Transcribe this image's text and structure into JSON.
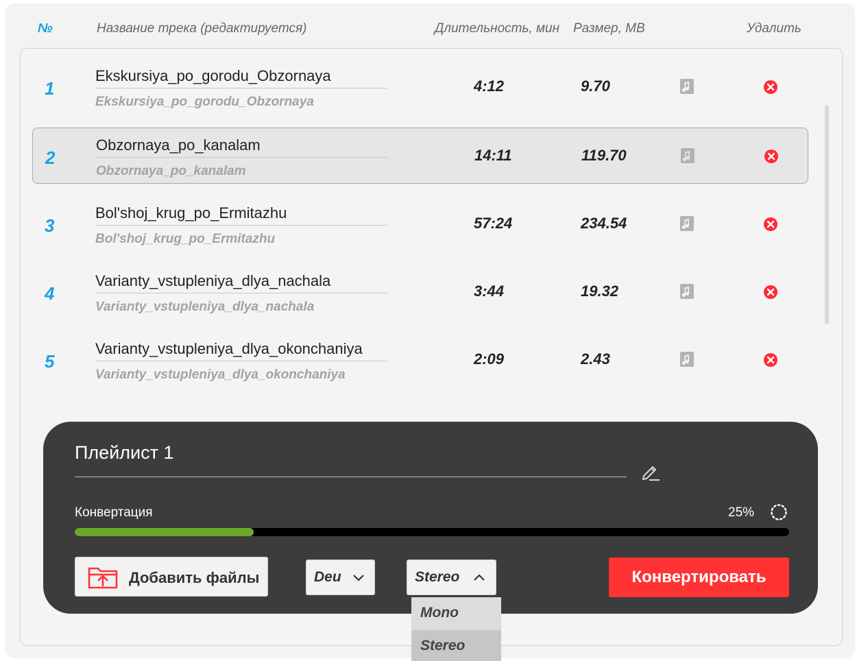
{
  "headers": {
    "num": "№",
    "title": "Название трека (редактируется)",
    "duration": "Длительность, мин",
    "size": "Размер, MB",
    "delete": "Удалить"
  },
  "tracks": [
    {
      "num": "1",
      "name": "Ekskursiya_po_gorodu_Obzornaya",
      "original": "Ekskursiya_po_gorodu_Obzornaya",
      "duration": "4:12",
      "size": "9.70"
    },
    {
      "num": "2",
      "name": "Obzornaya_po_kanalam",
      "original": "Obzornaya_po_kanalam",
      "duration": "14:11",
      "size": "119.70"
    },
    {
      "num": "3",
      "name": "Bol'shoj_krug_po_Ermitazhu",
      "original": "Bol'shoj_krug_po_Ermitazhu",
      "duration": "57:24",
      "size": "234.54"
    },
    {
      "num": "4",
      "name": "Varianty_vstupleniya_dlya_nachala",
      "original": "Varianty_vstupleniya_dlya_nachala",
      "duration": "3:44",
      "size": "19.32"
    },
    {
      "num": "5",
      "name": "Varianty_vstupleniya_dlya_okonchaniya",
      "original": "Varianty_vstupleniya_dlya_okonchaniya",
      "duration": "2:09",
      "size": "2.43"
    }
  ],
  "selected_track": 2,
  "playlist": {
    "name": "Плейлист 1",
    "conversion_label": "Конвертация",
    "progress_text": "25%",
    "progress_value": 25
  },
  "controls": {
    "add_files": "Добавить файлы",
    "language": "Deu",
    "channel": "Stereo",
    "channel_options": [
      "Mono",
      "Stereo"
    ],
    "convert": "Конвертировать"
  },
  "colors": {
    "accent_blue": "#1aa3e0",
    "danger_red": "#ff3333",
    "progress_green": "#6aa82a",
    "panel_dark": "#3c3c3c"
  }
}
